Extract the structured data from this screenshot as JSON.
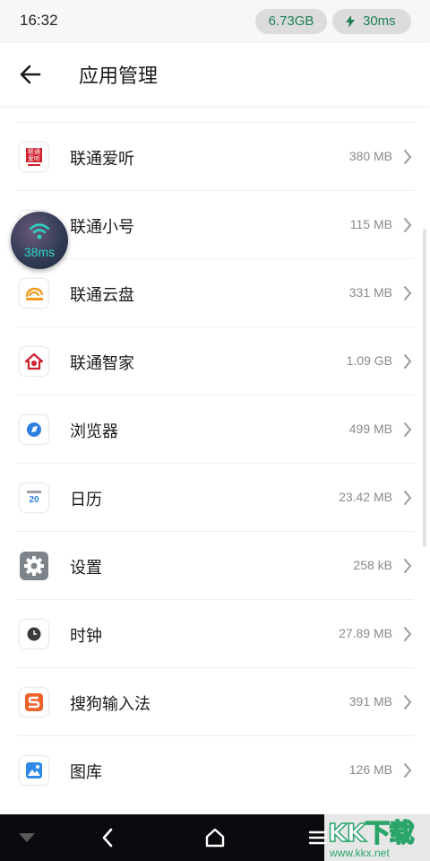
{
  "status_bar": {
    "time": "16:32",
    "memory": "6.73GB",
    "ping": "30ms"
  },
  "header": {
    "title": "应用管理"
  },
  "apps": [
    {
      "name": "联通爱听",
      "size": "380 MB",
      "icon": "liantong-aiting-icon"
    },
    {
      "name": "联通小号",
      "size": "115 MB",
      "icon": "liantong-xiaohao-icon"
    },
    {
      "name": "联通云盘",
      "size": "331 MB",
      "icon": "liantong-yunpan-icon"
    },
    {
      "name": "联通智家",
      "size": "1.09 GB",
      "icon": "liantong-zhijia-icon"
    },
    {
      "name": "浏览器",
      "size": "499 MB",
      "icon": "browser-icon"
    },
    {
      "name": "日历",
      "size": "23.42 MB",
      "icon": "calendar-icon"
    },
    {
      "name": "设置",
      "size": "258 kB",
      "icon": "settings-gear-icon"
    },
    {
      "name": "时钟",
      "size": "27.89 MB",
      "icon": "clock-icon"
    },
    {
      "name": "搜狗输入法",
      "size": "391 MB",
      "icon": "sogou-input-icon"
    },
    {
      "name": "图库",
      "size": "126 MB",
      "icon": "gallery-icon"
    }
  ],
  "icon_texts": {
    "aiting": "联通爱听",
    "calendar_day": "20"
  },
  "float_widget": {
    "ping": "38ms"
  },
  "watermark": {
    "logo": "KK下载",
    "url": "www.kkx.net"
  },
  "colors": {
    "accent_green": "#1e7f55",
    "ping_cyan": "#2bd6c3",
    "nav_bar": "#0b0b0f"
  }
}
